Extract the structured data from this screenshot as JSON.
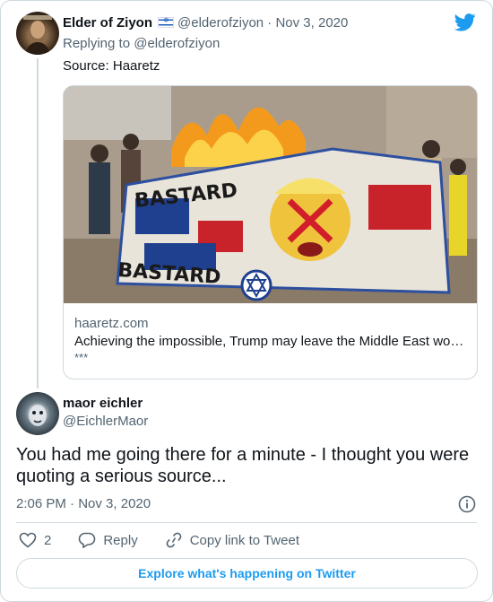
{
  "quoted_tweet": {
    "author_name": "Elder of Ziyon",
    "author_flag_icon": "israel-flag-icon",
    "author_handle": "@elderofziyon",
    "separator": "·",
    "date": "Nov 3, 2020",
    "replying_prefix": "Replying to",
    "replying_handle": "@elderofziyon",
    "text": "Source: Haaretz",
    "link_card": {
      "image_icon": "news-photo",
      "image_banner_text": "BASTARD",
      "domain": "haaretz.com",
      "title": "Achieving the impossible, Trump may leave the Middle East wo…",
      "description": "***"
    }
  },
  "reply_tweet": {
    "author_name": "maor eichler",
    "author_handle": "@EichlerMaor",
    "text": "You had me going there for a minute - I thought you were quoting a serious source...",
    "time": "2:06 PM",
    "separator": "·",
    "date": "Nov 3, 2020"
  },
  "actions": {
    "like_count": "2",
    "reply_label": "Reply",
    "copy_link_label": "Copy link to Tweet"
  },
  "explore_label": "Explore what's happening on Twitter",
  "colors": {
    "accent": "#1d9bf0",
    "muted_text": "#536471",
    "border": "#cfd9de"
  }
}
